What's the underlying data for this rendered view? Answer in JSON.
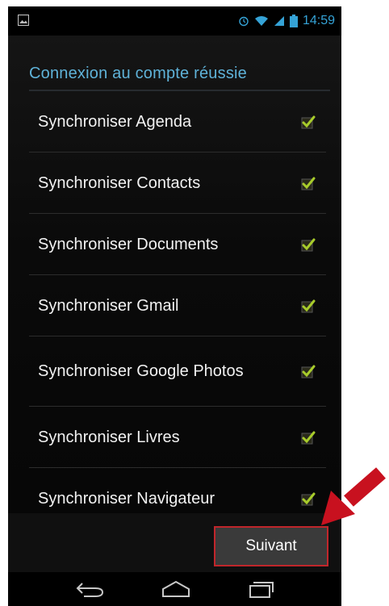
{
  "status_bar": {
    "time": "14:59",
    "icons": [
      "image-icon",
      "alarm-icon",
      "wifi-icon",
      "signal-icon",
      "battery-icon"
    ]
  },
  "title": "Connexion au compte réussie",
  "sync_items": [
    {
      "label": "Synchroniser Agenda",
      "checked": true
    },
    {
      "label": "Synchroniser Contacts",
      "checked": true
    },
    {
      "label": "Synchroniser Documents",
      "checked": true
    },
    {
      "label": "Synchroniser Gmail",
      "checked": true
    },
    {
      "label": "Synchroniser Google Photos",
      "checked": true
    },
    {
      "label": "Synchroniser Livres",
      "checked": true
    },
    {
      "label": "Synchroniser Navigateur",
      "checked": true
    }
  ],
  "next_button": {
    "label": "Suivant"
  },
  "nav_bar": {
    "icons": [
      "back-icon",
      "home-icon",
      "recent-apps-icon"
    ]
  },
  "colors": {
    "accent": "#35a3d7",
    "title": "#5fb2d8",
    "check": "#a8cc2b",
    "highlight": "#c0262b"
  }
}
